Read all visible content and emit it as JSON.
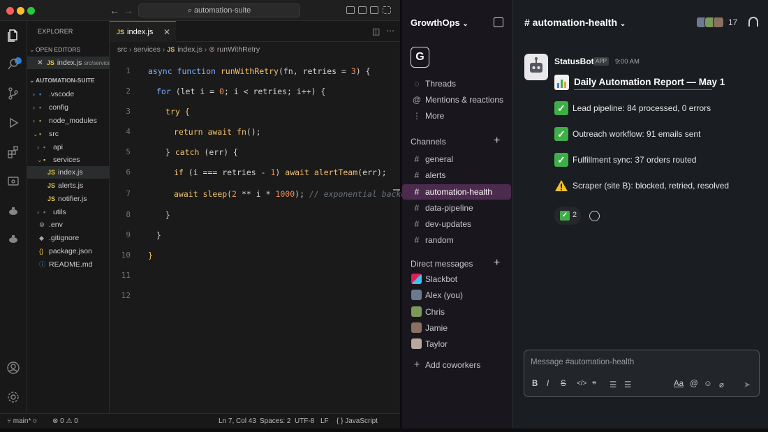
{
  "vscode": {
    "search": "automation-suite",
    "explorer_title": "EXPLORER",
    "open_editors": "OPEN EDITORS",
    "open_file": "index.js",
    "open_file_path": "src/services",
    "project": "AUTOMATION-SUITE",
    "tree": {
      "vscode": ".vscode",
      "config": "config",
      "node_modules": "node_modules",
      "src": "src",
      "api": "api",
      "services": "services",
      "index": "index.js",
      "alerts": "alerts.js",
      "notifier": "notifier.js",
      "utils": "utils",
      "env": ".env",
      "gitignore": ".gitignore",
      "package": "package.json",
      "readme": "README.md"
    },
    "tab_label": "index.js",
    "breadcrumb": {
      "a": "src",
      "b": "services",
      "c": "index.js",
      "d": "runWithRetry"
    },
    "code": {
      "l1_kw": "async function ",
      "l1_fn": "runWithRetry",
      "l1_args": "(fn, retries = ",
      "l1_num": "3",
      "l1_end": ") {",
      "l2_kw": "for ",
      "l2_a": "(let i = ",
      "l2_num": "0",
      "l2_b": "; i < retries; i++) {",
      "l3": "try {",
      "l4_kw": "return await ",
      "l4_fn": "fn",
      "l4_end": "();",
      "l5_a": "} ",
      "l5_kw": "catch ",
      "l5_b": "(err) {",
      "l6_kw": "if ",
      "l6_a": "(i === retries - ",
      "l6_num": "1",
      "l6_b": ") ",
      "l6_kw2": "await ",
      "l6_fn": "alertTeam",
      "l6_c": "(err);",
      "l7_kw": "await ",
      "l7_fn": "sleep",
      "l7_a": "(",
      "l7_n1": "2",
      "l7_b": " ** i * ",
      "l7_n2": "1000",
      "l7_c": "); ",
      "l7_cm": "// exponential backoff",
      "l8": "}",
      "l9": "}",
      "l10": "}"
    },
    "line_numbers": [
      "1",
      "2",
      "3",
      "4",
      "5",
      "6",
      "7",
      "8",
      "9",
      "10",
      "11",
      "12"
    ],
    "status": {
      "branch": "main*",
      "errors": "0",
      "warnings": "0",
      "position": "Ln 7, Col 43",
      "spaces": "Spaces: 2",
      "encoding": "UTF-8",
      "eol": "LF",
      "language": "JavaScript",
      "language_prefix": "{ }"
    }
  },
  "slack": {
    "workspace": "GrowthOps",
    "workspace_initial": "G",
    "nav": {
      "threads": "Threads",
      "mentions": "Mentions & reactions",
      "more": "More"
    },
    "channels_header": "Channels",
    "channels": [
      "general",
      "alerts",
      "automation-health",
      "data-pipeline",
      "dev-updates",
      "random"
    ],
    "dm_header": "Direct messages",
    "dms": [
      "Slackbot",
      "Alex (you)",
      "Chris",
      "Jamie",
      "Taylor"
    ],
    "add_coworkers": "Add coworkers",
    "channel_title": "# automation-health",
    "member_count": "17",
    "message": {
      "author": "StatusBot",
      "tag": "APP",
      "time": "9:00 AM",
      "title": "Daily Automation Report — May 1",
      "lines": [
        "Lead pipeline: 84 processed, 0 errors",
        "Outreach workflow: 91 emails sent",
        "Fulfillment sync: 37 orders routed",
        "Scraper (site B): blocked, retried, resolved"
      ],
      "reaction_count": "2"
    },
    "composer_placeholder": "Message #automation-health",
    "composer_tools": {
      "bold": "B",
      "italic": "I",
      "strike": "S",
      "code": "</>",
      "quote": "❞",
      "fonts": "Aa",
      "mention": "@"
    },
    "colors": {
      "selected": "#4c2b4e",
      "check": "#3fae49",
      "accent": "#2f7fd3"
    }
  }
}
